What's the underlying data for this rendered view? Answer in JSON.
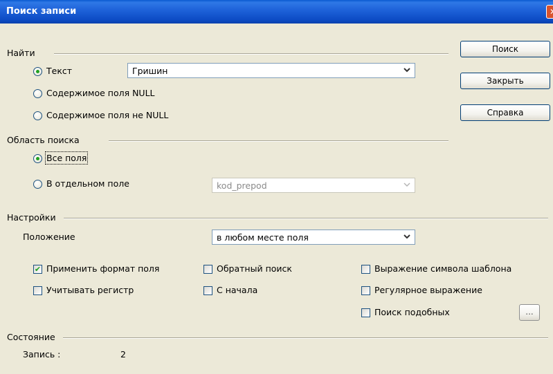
{
  "window": {
    "title": "Поиск записи"
  },
  "find": {
    "group_label": "Найти",
    "option_text": "Текст",
    "option_null": "Содержимое поля NULL",
    "option_not_null": "Содержимое поля не NULL",
    "search_value": "Гришин"
  },
  "area": {
    "group_label": "Область поиска",
    "option_all": "Все поля",
    "option_single": "В отдельном поле",
    "field_value": "kod_prepod"
  },
  "settings": {
    "group_label": "Настройки",
    "position_label": "Положение",
    "position_value": "в любом месте поля",
    "apply_format": "Применить формат поля",
    "match_case": "Учитывать регистр",
    "reverse_search": "Обратный поиск",
    "from_start": "С начала",
    "wildcard": "Выражение символа шаблона",
    "regex": "Регулярное выражение",
    "similarity": "Поиск подобных",
    "similarity_button": "..."
  },
  "status": {
    "group_label": "Состояние",
    "record_label": "Запись :",
    "record_value": "2"
  },
  "buttons": {
    "search": "Поиск",
    "close": "Закрыть",
    "help": "Справка"
  }
}
